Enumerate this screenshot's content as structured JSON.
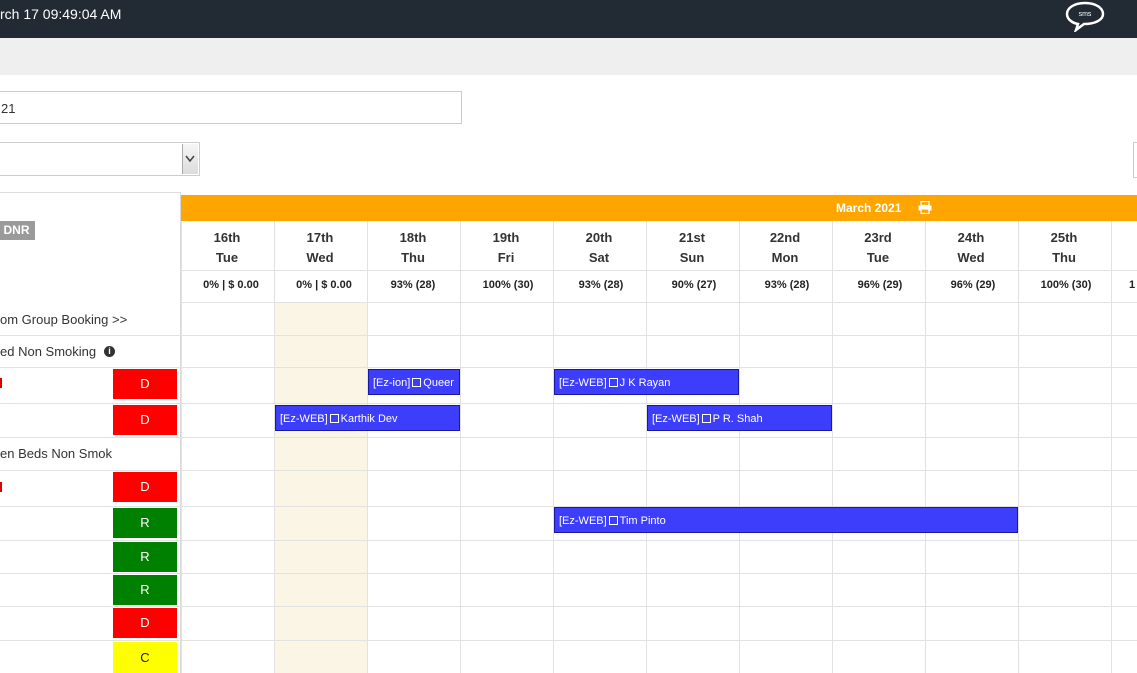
{
  "header": {
    "clock": "rch 17  09:49:04 AM",
    "sms_label": "sms"
  },
  "filters": {
    "date_value": "21"
  },
  "legend": {
    "dnr": "DNR"
  },
  "calendar": {
    "month_label": "March 2021",
    "days": [
      {
        "date": "16th",
        "dow": "Tue",
        "occ": "0% | $ 0.00"
      },
      {
        "date": "17th",
        "dow": "Wed",
        "occ": "0% | $ 0.00"
      },
      {
        "date": "18th",
        "dow": "Thu",
        "occ": "93% (28)"
      },
      {
        "date": "19th",
        "dow": "Fri",
        "occ": "100% (30)"
      },
      {
        "date": "20th",
        "dow": "Sat",
        "occ": "93% (28)"
      },
      {
        "date": "21st",
        "dow": "Sun",
        "occ": "90% (27)"
      },
      {
        "date": "22nd",
        "dow": "Mon",
        "occ": "93% (28)"
      },
      {
        "date": "23rd",
        "dow": "Tue",
        "occ": "96% (29)"
      },
      {
        "date": "24th",
        "dow": "Wed",
        "occ": "96% (29)"
      },
      {
        "date": "25th",
        "dow": "Thu",
        "occ": "100% (30)"
      },
      {
        "date": "",
        "dow": "",
        "occ": "1"
      }
    ]
  },
  "rows": {
    "group_booking": "om Group Booking >>",
    "room_type_1": "ed Non Smoking",
    "room_type_2": "en Beds Non Smok",
    "statuses": [
      "D",
      "D",
      "D",
      "R",
      "R",
      "R",
      "D",
      "C"
    ]
  },
  "bookings": [
    {
      "source": "[Ez-ion]",
      "guest": "Queer"
    },
    {
      "source": "[Ez-WEB]",
      "guest": "J K Rayan"
    },
    {
      "source": "[Ez-WEB]",
      "guest": "Karthik Dev"
    },
    {
      "source": "[Ez-WEB]",
      "guest": "P R. Shah"
    },
    {
      "source": "[Ez-WEB]",
      "guest": "Tim Pinto"
    }
  ],
  "colors": {
    "month_bar": "#ffa500",
    "booking": "#3d3dfc",
    "status_dirty": "#ff0000",
    "status_ready": "#008000",
    "status_clean": "#ffff00",
    "today_column": "#faf5e4"
  },
  "icons": [
    "sms-chat-icon",
    "printer-icon",
    "info-icon",
    "note-icon",
    "dropdown-arrow-icon"
  ]
}
